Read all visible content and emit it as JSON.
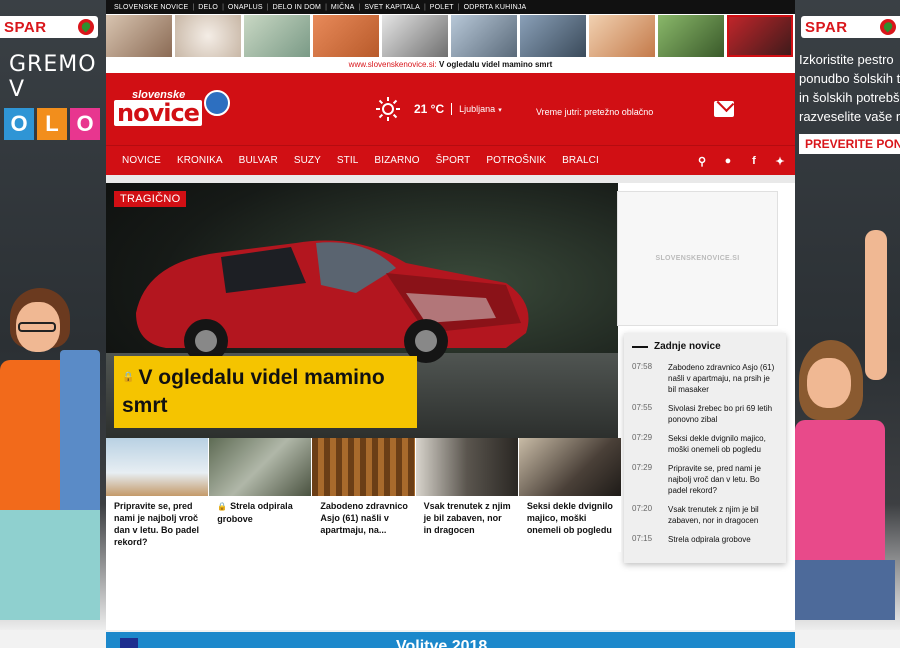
{
  "ads": {
    "brand": "SPAR",
    "left_slogan": "GREMO V",
    "left_letters": [
      "O",
      "L",
      "O"
    ],
    "left_letter_colors": [
      "#2f95d5",
      "#f28e1c",
      "#e8368f"
    ],
    "right_lines": [
      "Izkoristite pestro",
      "ponudbo šolskih t",
      "in šolskih potrebš",
      "razveselite vaše m"
    ],
    "right_cta": "PREVERITE PON"
  },
  "topbar": {
    "links": [
      "SLOVENSKE NOVICE",
      "DELO",
      "ONAPLUS",
      "DELO IN DOM",
      "MIČNA",
      "SVET KAPITALA",
      "POLET",
      "ODPRTA KUHINJA"
    ]
  },
  "promo": {
    "url": "www.slovenskenovice.si:",
    "title": "V ogledalu videl mamino smrt"
  },
  "masthead": {
    "logo_top": "slovenske",
    "logo_main": "novice",
    "temperature": "21 °C",
    "city": "Ljubljana",
    "forecast": "Vreme jutri: pretežno oblačno"
  },
  "nav": {
    "items": [
      "NOVICE",
      "KRONIKA",
      "BULVAR",
      "SUZY",
      "STIL",
      "BIZARNO",
      "ŠPORT",
      "POTROŠNIK",
      "BRALCI"
    ]
  },
  "hero": {
    "tag": "TRAGIČNO",
    "headline": "V ogledalu videl mamino smrt"
  },
  "adbox": {
    "label": "SLOVENSKENOVICE.SI"
  },
  "latest": {
    "heading": "Zadnje novice",
    "items": [
      {
        "time": "07:58",
        "title": "Zabodeno zdravnico Asjo (61) našli v apartmaju, na prsih je bil masaker"
      },
      {
        "time": "07:55",
        "title": "Sivolasi žrebec bo pri 69 letih ponovno zibal"
      },
      {
        "time": "07:29",
        "title": "Seksi dekle dvignilo majico, moški onemeli ob pogledu"
      },
      {
        "time": "07:29",
        "title": "Pripravite se, pred nami je najbolj vroč dan v letu. Bo padel rekord?"
      },
      {
        "time": "07:20",
        "title": "Vsak trenutek z njim je bil zabaven, nor in dragocen"
      },
      {
        "time": "07:15",
        "title": "Strela odpirala grobove"
      }
    ]
  },
  "cards": [
    {
      "title": "Pripravite se, pred nami je najbolj vroč dan v letu. Bo padel rekord?",
      "locked": false,
      "color": "#c9d9e6"
    },
    {
      "title": "Strela odpirala grobove",
      "locked": true,
      "color": "#7e8a76"
    },
    {
      "title": "Zabodeno zdravnico Asjo (61) našli v apartmaju, na...",
      "locked": false,
      "color": "#8a5a2a"
    },
    {
      "title": "Vsak trenutek z njim je bil zabaven, nor in dragocen",
      "locked": false,
      "color": "#6f6a62"
    },
    {
      "title": "Seksi dekle dvignilo majico, moški onemeli ob pogledu",
      "locked": false,
      "color": "#9a8e7e"
    }
  ],
  "bottom": {
    "title": "Volitve 2018"
  },
  "colors": {
    "brand_red": "#d10f14",
    "headline_yellow": "#f5c400",
    "accent_blue": "#1c88cb"
  }
}
